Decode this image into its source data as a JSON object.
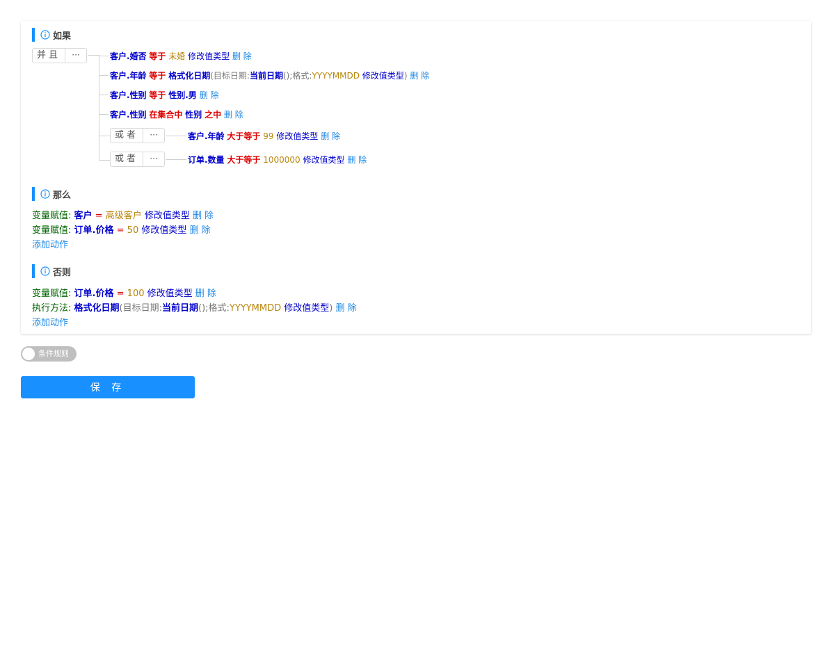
{
  "if_section": {
    "title": "如果",
    "group": {
      "label": "并且",
      "more": "···"
    },
    "conditions": [
      {
        "left": "客户.婚否",
        "op": "等于",
        "value": "未婚",
        "modify": "修改值类型",
        "delete": "删 除"
      },
      {
        "left": "客户.年龄",
        "op": "等于",
        "func": "格式化日期",
        "p1_open": "(目标日期:",
        "p1_val": "当前日期",
        "p1_close": "();格式:",
        "p2_val": "YYYYMMDD",
        "modify": "修改值类型",
        "close": ")",
        "delete": "删 除"
      },
      {
        "left": "客户.性别",
        "op": "等于",
        "value": "性别.男",
        "delete": "删 除"
      },
      {
        "left": "客户.性别",
        "op": "在集合中",
        "value": "性别",
        "op2": "之中",
        "delete": "删 除"
      }
    ],
    "or_groups": [
      {
        "label": "或者",
        "more": "···",
        "left": "客户.年龄",
        "op": "大于等于",
        "value": "99",
        "modify": "修改值类型",
        "delete": "删 除"
      },
      {
        "label": "或者",
        "more": "···",
        "left": "订单.数量",
        "op": "大于等于",
        "value": "1000000",
        "modify": "修改值类型",
        "delete": "删 除"
      }
    ]
  },
  "then_section": {
    "title": "那么",
    "actions": [
      {
        "label": "变量赋值:",
        "target": "客户",
        "eq": "=",
        "value": "高级客户",
        "modify": "修改值类型",
        "delete": "删 除"
      },
      {
        "label": "变量赋值:",
        "target": "订单.价格",
        "eq": "=",
        "value": "50",
        "modify": "修改值类型",
        "delete": "删 除"
      }
    ],
    "add_action": "添加动作"
  },
  "else_section": {
    "title": "否则",
    "assign": {
      "label": "变量赋值:",
      "target": "订单.价格",
      "eq": "=",
      "value": "100",
      "modify": "修改值类型",
      "delete": "删 除"
    },
    "method": {
      "label": "执行方法:",
      "func": "格式化日期",
      "p1_open": "(目标日期:",
      "p1_val": "当前日期",
      "p1_close": "();格式:",
      "p2_val": "YYYYMMDD",
      "modify": "修改值类型",
      "close": ")",
      "delete": "删 除"
    },
    "add_action": "添加动作"
  },
  "toggle": {
    "label": "条件规则",
    "on": false
  },
  "save_button": "保 存"
}
